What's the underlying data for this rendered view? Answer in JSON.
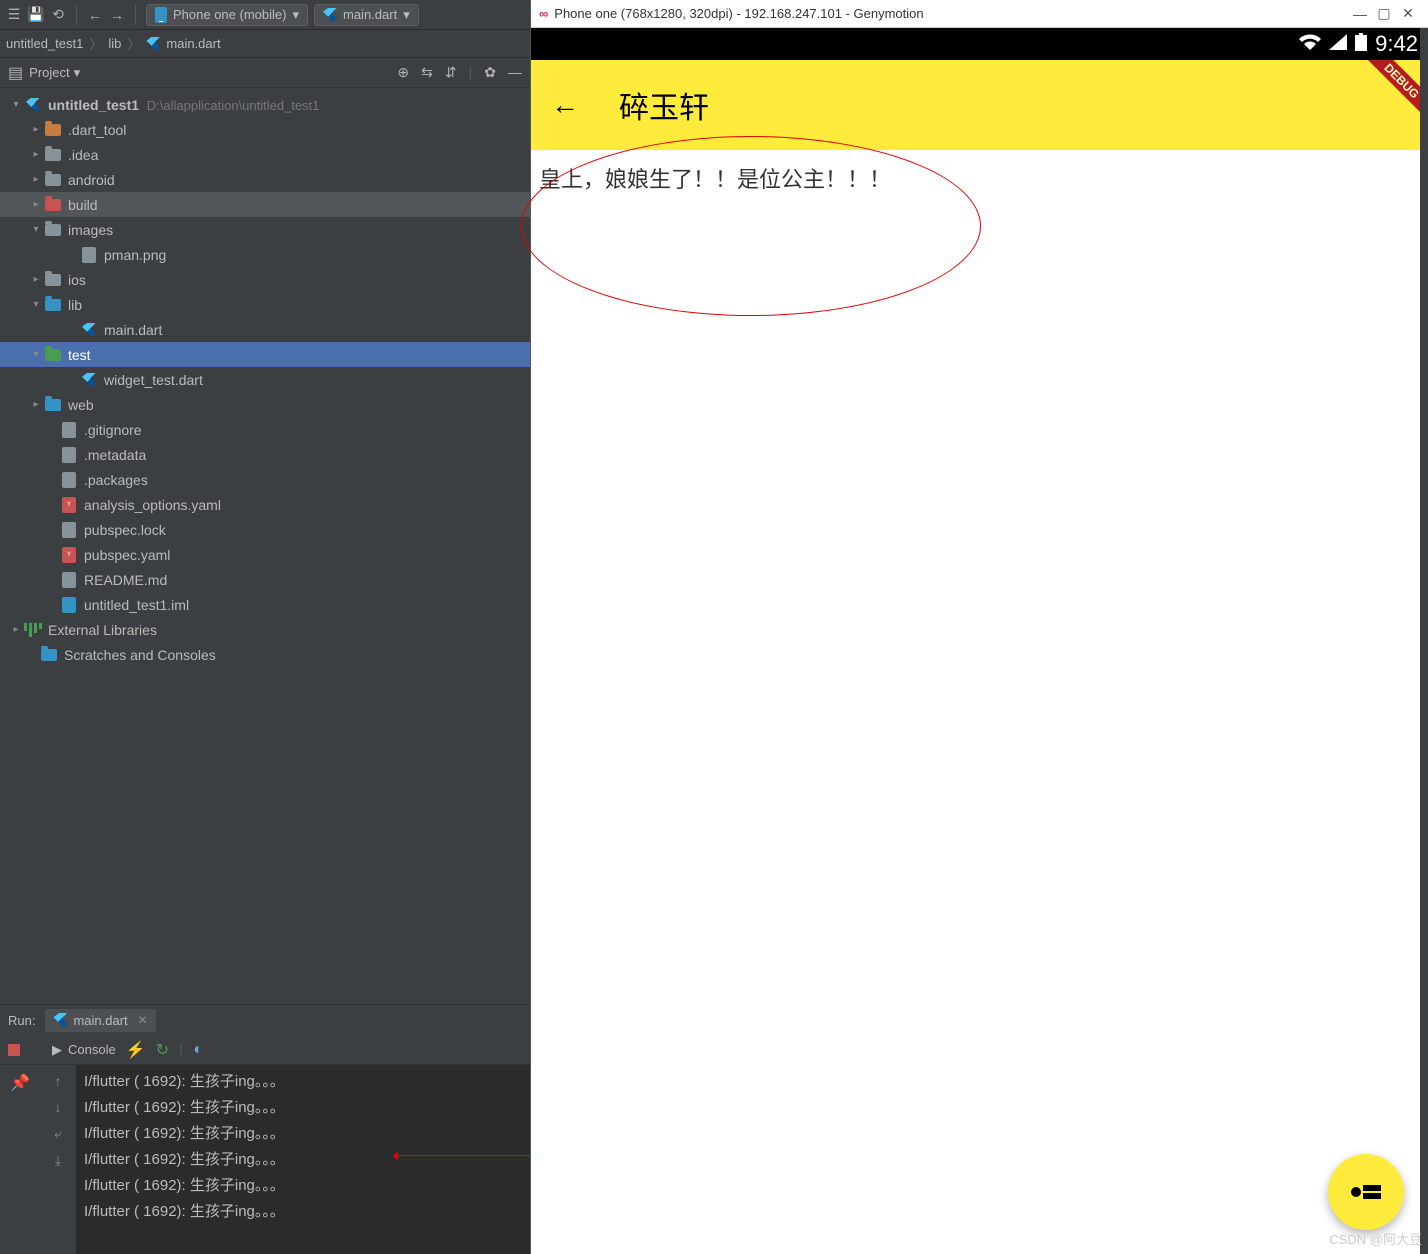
{
  "toolbar": {
    "device_dropdown": "Phone one (mobile)",
    "file_dropdown": "main.dart"
  },
  "breadcrumb": {
    "project": "untitled_test1",
    "folder": "lib",
    "file": "main.dart"
  },
  "project_panel": {
    "label": "Project"
  },
  "tree": {
    "root_name": "untitled_test1",
    "root_path": "D:\\allapplication\\untitled_test1",
    "dart_tool": ".dart_tool",
    "idea": ".idea",
    "android": "android",
    "build": "build",
    "images": "images",
    "pman": "pman.png",
    "ios": "ios",
    "lib": "lib",
    "main_dart": "main.dart",
    "test": "test",
    "widget_test": "widget_test.dart",
    "web": "web",
    "gitignore": ".gitignore",
    "metadata": ".metadata",
    "packages": ".packages",
    "analysis": "analysis_options.yaml",
    "pubspec_lock": "pubspec.lock",
    "pubspec_yaml": "pubspec.yaml",
    "readme": "README.md",
    "iml": "untitled_test1.iml",
    "ext_lib": "External Libraries",
    "scratches": "Scratches and Consoles"
  },
  "run": {
    "label": "Run:",
    "tab": "main.dart",
    "console_label": "Console",
    "lines": [
      "I/flutter ( 1692): 生孩子ing。。。",
      "I/flutter ( 1692): 生孩子ing。。。",
      "I/flutter ( 1692): 生孩子ing。。。",
      "I/flutter ( 1692): 生孩子ing。。。",
      "I/flutter ( 1692): 生孩子ing。。。",
      "I/flutter ( 1692): 生孩子ing。。。"
    ]
  },
  "emulator": {
    "window_title": "Phone one (768x1280, 320dpi) - 192.168.247.101 - Genymotion",
    "time": "9:42",
    "app_title": "碎玉轩",
    "content_text": "皇上，娘娘生了！！是位公主！！！",
    "debug_banner": "DEBUG"
  },
  "watermark": "CSDN @阿大豆"
}
